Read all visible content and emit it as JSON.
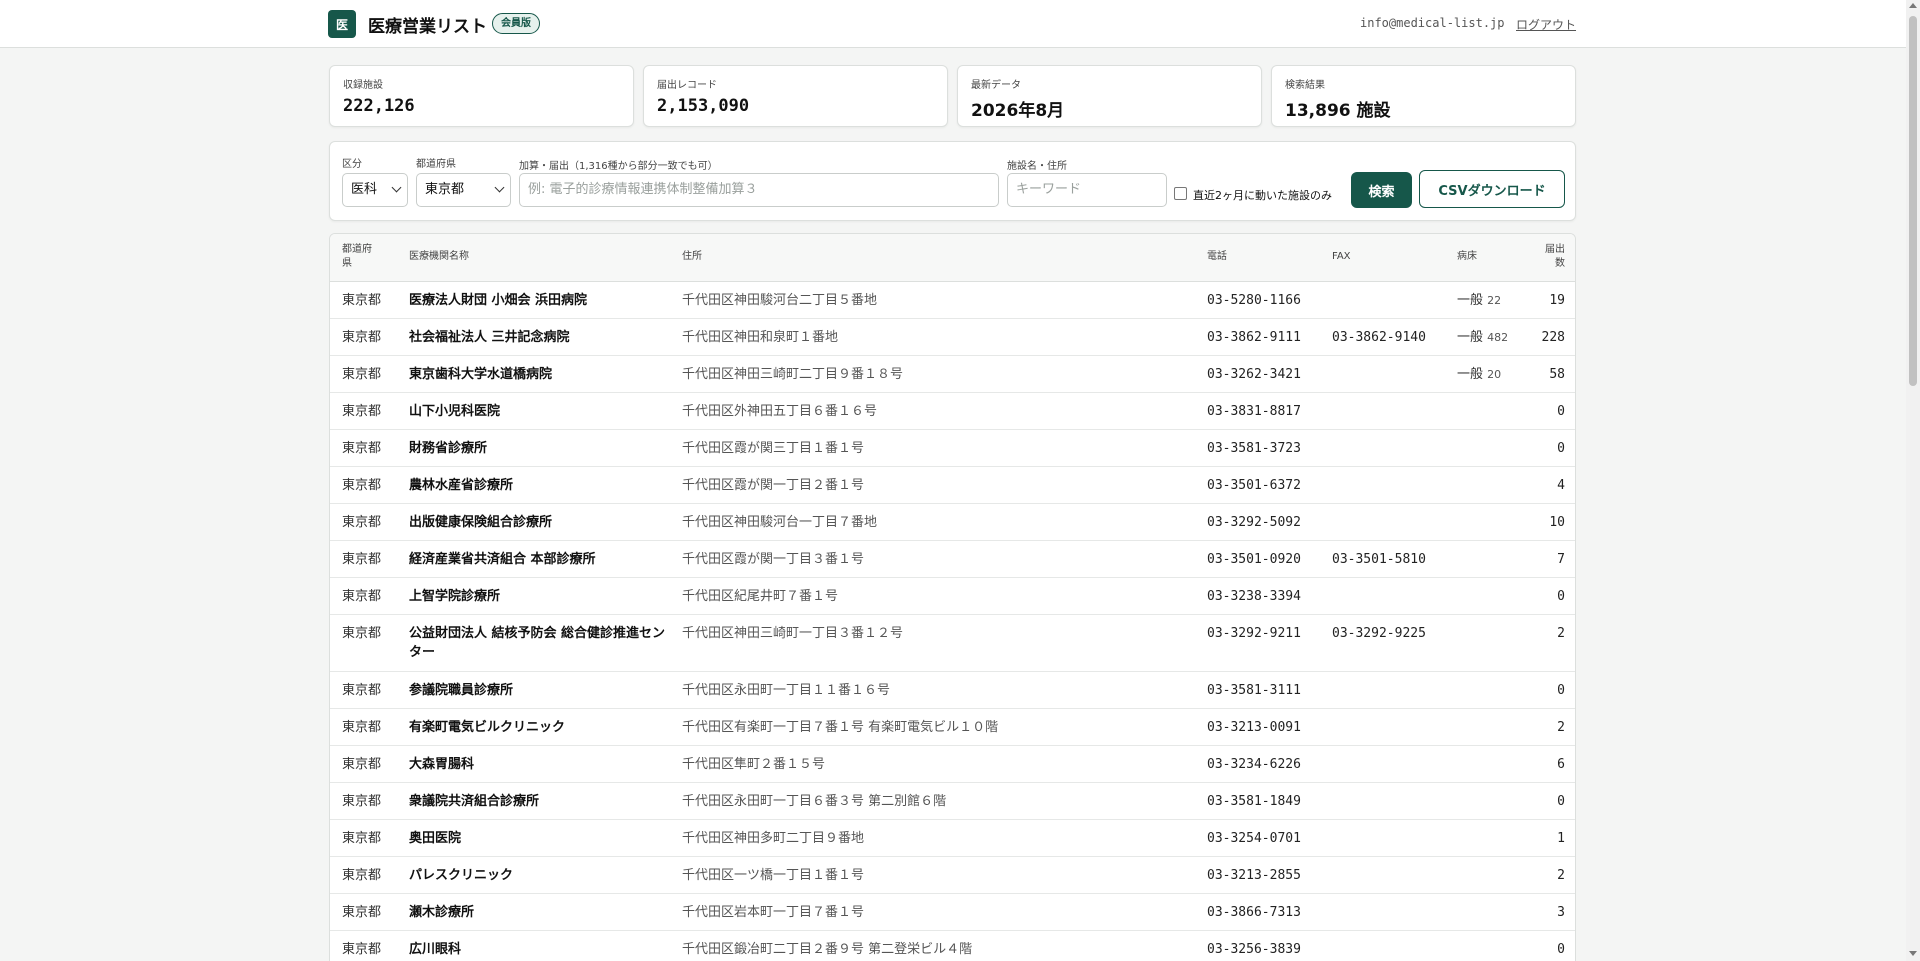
{
  "header": {
    "logo_char": "医",
    "app_title": "医療営業リスト",
    "badge": "会員版",
    "user_email": "info@medical-list.jp",
    "logout": "ログアウト"
  },
  "stats": [
    {
      "label": "収録施設",
      "value": "222,126"
    },
    {
      "label": "届出レコード",
      "value": "2,153,090"
    },
    {
      "label": "最新データ",
      "value": "2026年8月"
    },
    {
      "label": "検索結果",
      "value": "13,896 施設"
    }
  ],
  "filters": {
    "category_label": "区分",
    "category_value": "医科",
    "pref_label": "都道府県",
    "pref_value": "東京都",
    "addon_label": "加算・届出（1,316種から部分一致でも可）",
    "addon_placeholder": "例: 電子的診療情報連携体制整備加算３",
    "name_label": "施設名・住所",
    "name_placeholder": "キーワード",
    "recent_only_label": "直近2ヶ月に動いた施設のみ",
    "search_button": "検索",
    "csv_button": "CSVダウンロード"
  },
  "table": {
    "columns": [
      "都道府\n県",
      "医療機関名称",
      "住所",
      "電話",
      "FAX",
      "病床",
      "届出\n数"
    ],
    "rows": [
      {
        "pref": "東京都",
        "name": "医療法人財団 小畑会 浜田病院",
        "addr": "千代田区神田駿河台二丁目５番地",
        "tel": "03-5280-1166",
        "fax": "",
        "bed_type": "一般",
        "bed_count": "22",
        "count": "19"
      },
      {
        "pref": "東京都",
        "name": "社会福祉法人 三井記念病院",
        "addr": "千代田区神田和泉町１番地",
        "tel": "03-3862-9111",
        "fax": "03-3862-9140",
        "bed_type": "一般",
        "bed_count": "482",
        "count": "228"
      },
      {
        "pref": "東京都",
        "name": "東京歯科大学水道橋病院",
        "addr": "千代田区神田三崎町二丁目９番１８号",
        "tel": "03-3262-3421",
        "fax": "",
        "bed_type": "一般",
        "bed_count": "20",
        "count": "58"
      },
      {
        "pref": "東京都",
        "name": "山下小児科医院",
        "addr": "千代田区外神田五丁目６番１６号",
        "tel": "03-3831-8817",
        "fax": "",
        "bed_type": "",
        "bed_count": "",
        "count": "0"
      },
      {
        "pref": "東京都",
        "name": "財務省診療所",
        "addr": "千代田区霞が関三丁目１番１号",
        "tel": "03-3581-3723",
        "fax": "",
        "bed_type": "",
        "bed_count": "",
        "count": "0"
      },
      {
        "pref": "東京都",
        "name": "農林水産省診療所",
        "addr": "千代田区霞が関一丁目２番１号",
        "tel": "03-3501-6372",
        "fax": "",
        "bed_type": "",
        "bed_count": "",
        "count": "4"
      },
      {
        "pref": "東京都",
        "name": "出版健康保険組合診療所",
        "addr": "千代田区神田駿河台一丁目７番地",
        "tel": "03-3292-5092",
        "fax": "",
        "bed_type": "",
        "bed_count": "",
        "count": "10"
      },
      {
        "pref": "東京都",
        "name": "経済産業省共済組合 本部診療所",
        "addr": "千代田区霞が関一丁目３番１号",
        "tel": "03-3501-0920",
        "fax": "03-3501-5810",
        "bed_type": "",
        "bed_count": "",
        "count": "7"
      },
      {
        "pref": "東京都",
        "name": "上智学院診療所",
        "addr": "千代田区紀尾井町７番１号",
        "tel": "03-3238-3394",
        "fax": "",
        "bed_type": "",
        "bed_count": "",
        "count": "0"
      },
      {
        "pref": "東京都",
        "name": "公益財団法人 結核予防会 総合健診推進センター",
        "addr": "千代田区神田三崎町一丁目３番１２号",
        "tel": "03-3292-9211",
        "fax": "03-3292-9225",
        "bed_type": "",
        "bed_count": "",
        "count": "2"
      },
      {
        "pref": "東京都",
        "name": "参議院職員診療所",
        "addr": "千代田区永田町一丁目１１番１６号",
        "tel": "03-3581-3111",
        "fax": "",
        "bed_type": "",
        "bed_count": "",
        "count": "0"
      },
      {
        "pref": "東京都",
        "name": "有楽町電気ビルクリニック",
        "addr": "千代田区有楽町一丁目７番１号 有楽町電気ビル１０階",
        "tel": "03-3213-0091",
        "fax": "",
        "bed_type": "",
        "bed_count": "",
        "count": "2"
      },
      {
        "pref": "東京都",
        "name": "大森胃腸科",
        "addr": "千代田区隼町２番１５号",
        "tel": "03-3234-6226",
        "fax": "",
        "bed_type": "",
        "bed_count": "",
        "count": "6"
      },
      {
        "pref": "東京都",
        "name": "衆議院共済組合診療所",
        "addr": "千代田区永田町一丁目６番３号 第二別館６階",
        "tel": "03-3581-1849",
        "fax": "",
        "bed_type": "",
        "bed_count": "",
        "count": "0"
      },
      {
        "pref": "東京都",
        "name": "奥田医院",
        "addr": "千代田区神田多町二丁目９番地",
        "tel": "03-3254-0701",
        "fax": "",
        "bed_type": "",
        "bed_count": "",
        "count": "1"
      },
      {
        "pref": "東京都",
        "name": "パレスクリニック",
        "addr": "千代田区一ツ橋一丁目１番１号",
        "tel": "03-3213-2855",
        "fax": "",
        "bed_type": "",
        "bed_count": "",
        "count": "2"
      },
      {
        "pref": "東京都",
        "name": "瀬木診療所",
        "addr": "千代田区岩本町一丁目７番１号",
        "tel": "03-3866-7313",
        "fax": "",
        "bed_type": "",
        "bed_count": "",
        "count": "3"
      },
      {
        "pref": "東京都",
        "name": "広川眼科",
        "addr": "千代田区鍛冶町二丁目２番９号 第二登栄ビル４階",
        "tel": "03-3256-3839",
        "fax": "",
        "bed_type": "",
        "bed_count": "",
        "count": "0"
      }
    ]
  }
}
